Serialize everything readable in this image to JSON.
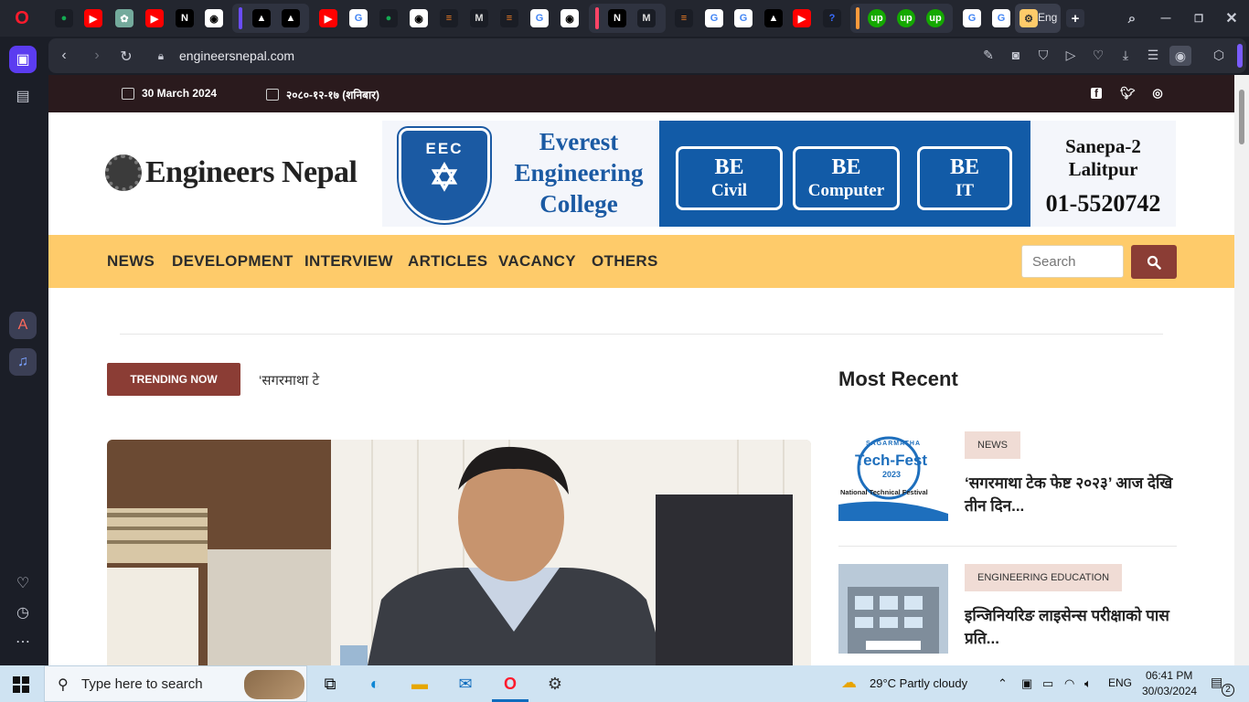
{
  "browser": {
    "url": "engineersnepal.com",
    "active_tab_title": "Eng"
  },
  "site": {
    "date_english": "30 March 2024",
    "date_nepali": "२०८०-१२-१७ (शनिबार)",
    "logo_text": "Engineers Nepal",
    "banner": {
      "crest_text": "EEC",
      "college_name": "Everest Engineering College",
      "programs": [
        {
          "top": "BE",
          "bottom": "Civil"
        },
        {
          "top": "BE",
          "bottom": "Computer"
        },
        {
          "top": "BE",
          "bottom": "IT"
        }
      ],
      "address": "Sanepa-2 Lalitpur",
      "phone": "01-5520742"
    },
    "nav": [
      "NEWS",
      "DEVELOPMENT",
      "INTERVIEW",
      "ARTICLES",
      "VACANCY",
      "OTHERS"
    ],
    "search_placeholder": "Search",
    "trending_label": "TRENDING NOW",
    "trending_text": "‘सगरमाथा टे",
    "most_recent_title": "Most Recent",
    "recent": [
      {
        "category": "NEWS",
        "headline": "‘सगरमाथा टेक फेष्ट २०२३’ आज देखि तीन दिन...",
        "thumb_title": "Tech-Fest",
        "thumb_sub": "SAGARMATHA",
        "thumb_year": "2023",
        "thumb_caption": "National Technical Festival"
      },
      {
        "category": "ENGINEERING EDUCATION",
        "headline": "इन्जिनियरिङ लाइसेन्स परीक्षाको पास प्रति..."
      }
    ]
  },
  "taskbar": {
    "search_placeholder": "Type here to search",
    "weather": "29°C  Partly cloudy",
    "language": "ENG",
    "time": "06:41 PM",
    "date": "30/03/2024",
    "notifications": "2"
  },
  "colors": {
    "nav_bg": "#fecb6a",
    "accent": "#8b3d35",
    "top_strip": "#2a1a1d",
    "banner_blue": "#125ba7"
  }
}
